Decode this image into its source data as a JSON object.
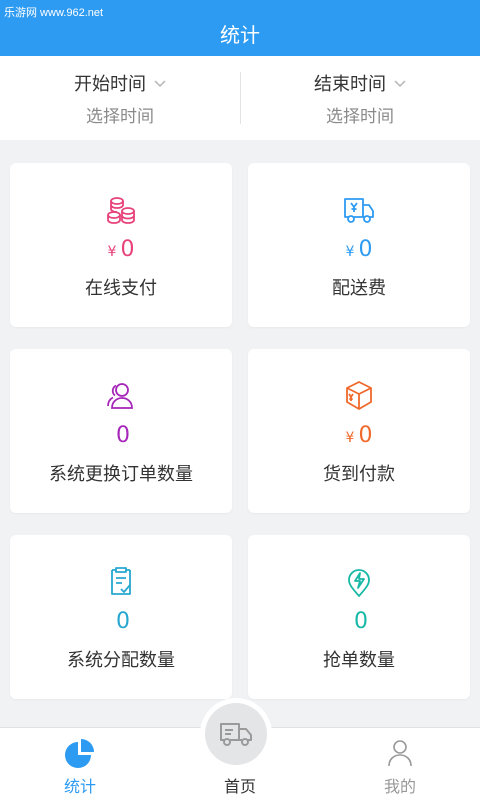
{
  "watermark": "乐游网 www.962.net",
  "header": {
    "title": "统计"
  },
  "time_filter": {
    "start": {
      "label": "开始时间",
      "value": "选择时间"
    },
    "end": {
      "label": "结束时间",
      "value": "选择时间"
    }
  },
  "cards": [
    {
      "label": "在线支付",
      "currency": "¥",
      "value": "0",
      "color": "#e8427a",
      "icon": "coins-icon"
    },
    {
      "label": "配送费",
      "currency": "¥",
      "value": "0",
      "color": "#2e9bf2",
      "icon": "delivery-truck-icon"
    },
    {
      "label": "系统更换订单数量",
      "currency": "",
      "value": "0",
      "color": "#a526b8",
      "icon": "users-icon"
    },
    {
      "label": "货到付款",
      "currency": "¥",
      "value": "0",
      "color": "#f0692c",
      "icon": "cash-box-icon"
    },
    {
      "label": "系统分配数量",
      "currency": "",
      "value": "0",
      "color": "#27a7d0",
      "icon": "clipboard-check-icon"
    },
    {
      "label": "抢单数量",
      "currency": "",
      "value": "0",
      "color": "#18b8a6",
      "icon": "grab-order-icon"
    }
  ],
  "tabbar": {
    "stats_label": "统计",
    "home_label": "首页",
    "mine_label": "我的",
    "active_color": "#2e9bf2"
  }
}
